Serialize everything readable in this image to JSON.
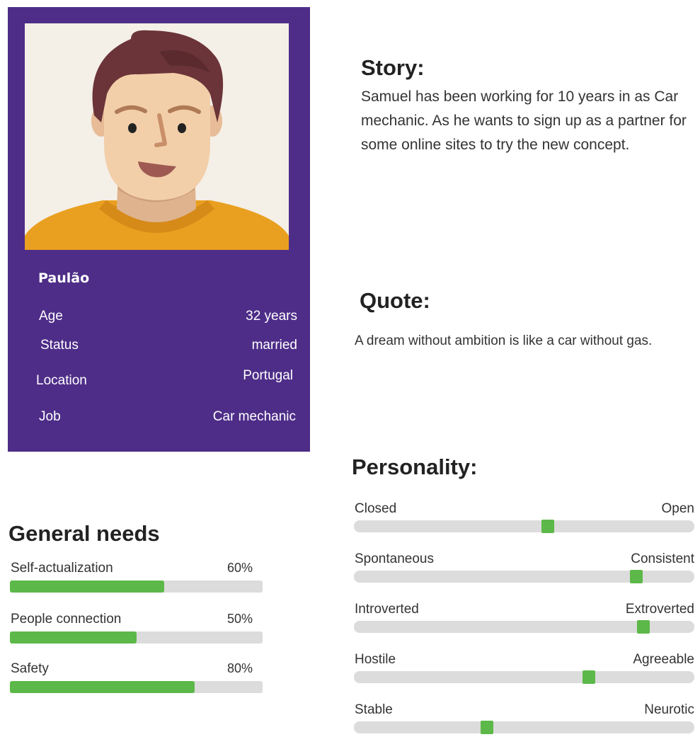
{
  "profile": {
    "name": "Paulão",
    "details": [
      {
        "key": "Age",
        "value": "32 years"
      },
      {
        "key": "Status",
        "value": "married"
      },
      {
        "key": "Location",
        "value": "Portugal"
      },
      {
        "key": "Job",
        "value": "Car mechanic"
      }
    ]
  },
  "story": {
    "title": "Story:",
    "text": "Samuel has been working for 10 years in as Car mechanic. As he wants to sign up as a partner for some online sites to try the new concept."
  },
  "quote": {
    "title": "Quote:",
    "text": "A dream without ambition is like a car without gas."
  },
  "needs": {
    "title": "General needs",
    "items": [
      {
        "label": "Self-actualization",
        "percent_label": "60%",
        "level": 0.61
      },
      {
        "label": "People connection",
        "percent_label": "50%",
        "level": 0.5
      },
      {
        "label": "Safety",
        "percent_label": "80%",
        "level": 0.73
      }
    ],
    "bar_color": "#5cb848"
  },
  "personality": {
    "title": "Personality:",
    "traits": [
      {
        "left": "Closed",
        "right": "Open",
        "level": 0.57
      },
      {
        "left": "Spontaneous",
        "right": "Consistent",
        "level": 0.83
      },
      {
        "left": "Introverted",
        "right": "Extroverted",
        "level": 0.85
      },
      {
        "left": "Hostile",
        "right": "Agreeable",
        "level": 0.69
      },
      {
        "left": "Stable",
        "right": "Neurotic",
        "level": 0.39
      }
    ]
  },
  "colors": {
    "card_bg": "#4e2d88",
    "accent_green": "#5cb848",
    "track_gray": "#dcdcdc"
  },
  "icons": {
    "avatar": "person-avatar-icon"
  }
}
